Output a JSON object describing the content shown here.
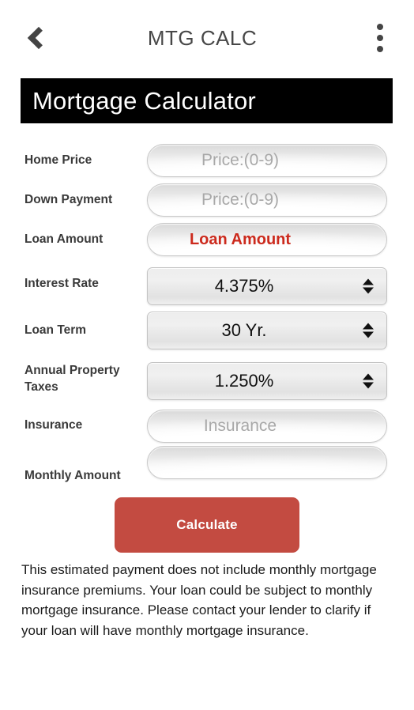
{
  "actionbar": {
    "back_icon": "chevron-left-icon",
    "title": "MTG CALC",
    "overflow_icon": "more-vertical-icon"
  },
  "banner": {
    "title": "Mortgage Calculator"
  },
  "form": {
    "rows": [
      {
        "label": "Home Price",
        "control": "text",
        "value": "",
        "placeholder": "Price:(0-9)"
      },
      {
        "label": "Down Payment",
        "control": "text",
        "value": "",
        "placeholder": "Price:(0-9)"
      },
      {
        "label": "Loan Amount",
        "control": "text",
        "value": "Loan Amount",
        "placeholder": "Loan Amount"
      },
      {
        "label": "Interest Rate",
        "control": "select",
        "value": "4.375%"
      },
      {
        "label": "Loan Term",
        "control": "select",
        "value": "30 Yr."
      },
      {
        "label": "Annual Property Taxes",
        "control": "select",
        "value": "1.250%"
      },
      {
        "label": "Insurance",
        "control": "text",
        "value": "",
        "placeholder": "Insurance"
      },
      {
        "label": "Monthly Amount",
        "control": "text",
        "value": "",
        "placeholder": ""
      }
    ]
  },
  "actions": {
    "calculate_label": "Calculate"
  },
  "disclaimer": {
    "text": "This estimated payment does not include monthly mortgage insurance premiums. Your loan could be subject to monthly mortgage insurance. Please contact your lender to clarify if your loan will have monthly mortgage insurance."
  },
  "colors": {
    "banner_bg": "#000000",
    "accent_red": "#cc2a1d",
    "button_red": "#c34b41",
    "label_text": "#3a3a3a",
    "placeholder_text": "#a8a8a8"
  }
}
